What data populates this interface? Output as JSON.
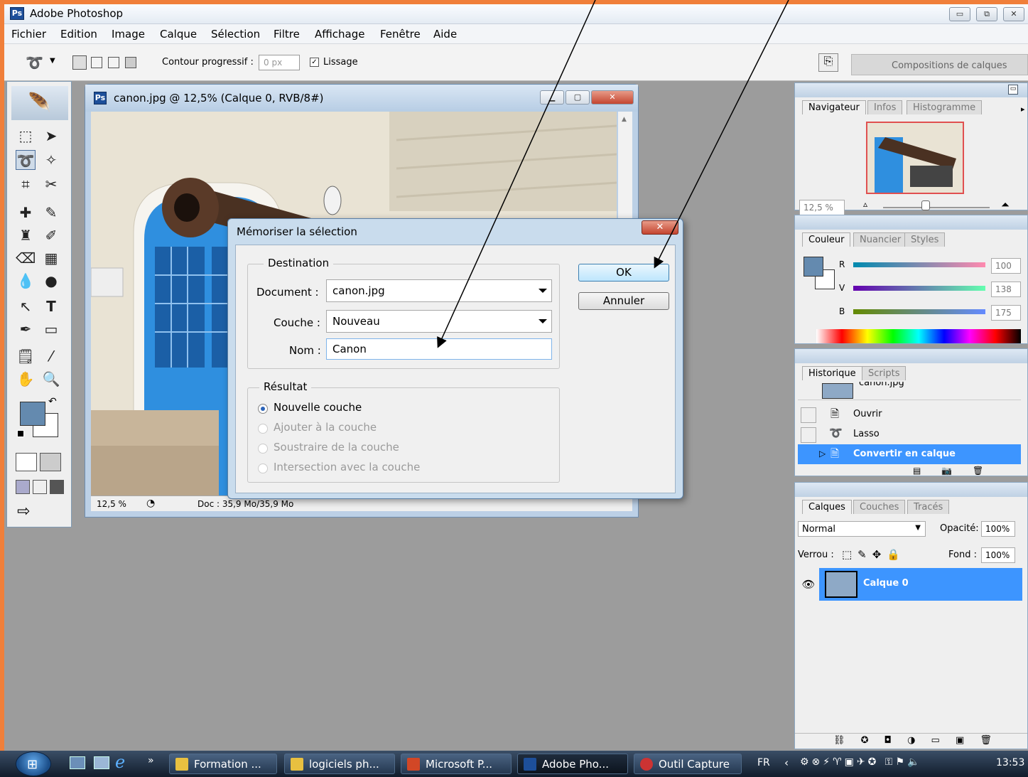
{
  "app": {
    "title": "Adobe Photoshop",
    "window_buttons": [
      "▭",
      "⧉",
      "✕"
    ]
  },
  "menu": [
    "Fichier",
    "Edition",
    "Image",
    "Calque",
    "Sélection",
    "Filtre",
    "Affichage",
    "Fenêtre",
    "Aide"
  ],
  "options": {
    "feather_label": "Contour progressif :",
    "feather_value": "0 px",
    "antialias_label": "Lissage",
    "antialias_checked": true,
    "compositions_label": "Compositions de calques"
  },
  "document": {
    "title": "canon.jpg @ 12,5% (Calque 0, RVB/8#)",
    "zoom": "12,5 %",
    "doc_info": "Doc : 35,9 Mo/35,9 Mo"
  },
  "dialog": {
    "title": "Mémoriser la sélection",
    "destination_group": "Destination",
    "document_label": "Document :",
    "document_value": "canon.jpg",
    "channel_label": "Couche :",
    "channel_value": "Nouveau",
    "name_label": "Nom :",
    "name_value": "Canon",
    "result_group": "Résultat",
    "operations": [
      {
        "label": "Nouvelle couche",
        "selected": true,
        "enabled": true
      },
      {
        "label": "Ajouter à la couche",
        "selected": false,
        "enabled": false
      },
      {
        "label": "Soustraire de la couche",
        "selected": false,
        "enabled": false
      },
      {
        "label": "Intersection avec la couche",
        "selected": false,
        "enabled": false
      }
    ],
    "ok_label": "OK",
    "cancel_label": "Annuler"
  },
  "navigator": {
    "tabs": [
      "Navigateur",
      "Infos",
      "Histogramme"
    ],
    "zoom": "12,5 %"
  },
  "color": {
    "tabs": [
      "Couleur",
      "Nuancier",
      "Styles"
    ],
    "channels": [
      {
        "label": "R",
        "value": "100"
      },
      {
        "label": "V",
        "value": "138"
      },
      {
        "label": "B",
        "value": "175"
      }
    ],
    "foreground": "#648aaf"
  },
  "history": {
    "tabs": [
      "Historique",
      "Scripts"
    ],
    "snapshot": "canon.jpg",
    "items": [
      {
        "label": "Ouvrir",
        "active": false
      },
      {
        "label": "Lasso",
        "active": false
      },
      {
        "label": "Convertir en calque",
        "active": true
      }
    ]
  },
  "layers": {
    "tabs": [
      "Calques",
      "Couches",
      "Tracés"
    ],
    "blend_mode": "Normal",
    "opacity_label": "Opacité:",
    "opacity": "100%",
    "lock_label": "Verrou :",
    "fill_label": "Fond :",
    "fill": "100%",
    "items": [
      {
        "name": "Calque 0",
        "active": true,
        "visible": true
      }
    ]
  },
  "taskbar": {
    "buttons": [
      {
        "label": "Formation ...",
        "active": false
      },
      {
        "label": "logiciels ph...",
        "active": false
      },
      {
        "label": "Microsoft P...",
        "active": false
      },
      {
        "label": "Adobe Pho...",
        "active": true
      },
      {
        "label": "Outil Capture",
        "active": false
      }
    ],
    "language": "FR",
    "clock": "13:53"
  },
  "colors": {
    "selection": "#3d95ff",
    "accent": "#f07f3a"
  }
}
